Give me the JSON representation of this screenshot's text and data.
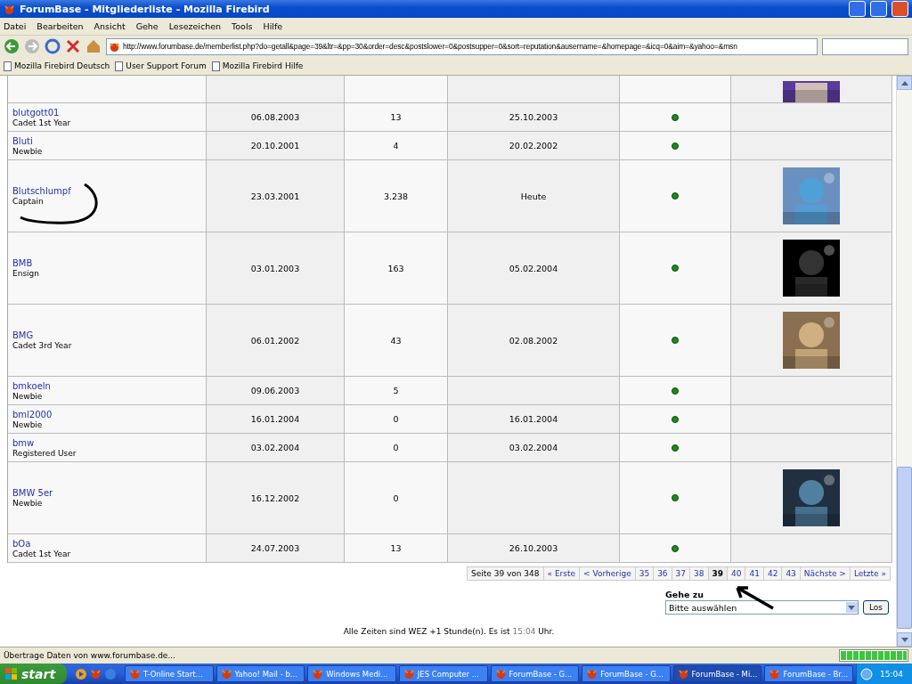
{
  "window": {
    "title": "ForumBase - Mitgliederliste - Mozilla Firebird"
  },
  "menu": [
    "Datei",
    "Bearbeiten",
    "Ansicht",
    "Gehe",
    "Lesezeichen",
    "Tools",
    "Hilfe"
  ],
  "address": {
    "url": "http://www.forumbase.de/memberlist.php?do=getall&page=39&ltr=&pp=30&order=desc&postslower=0&postsupper=0&sort=reputation&ausername=&homepage=&icq=0&aim=&yahoo=&msn"
  },
  "bookmarks": [
    "Mozilla Firebird Deutsch",
    "User Support Forum",
    "Mozilla Firebird Hilfe"
  ],
  "members": [
    {
      "has_avatar": true
    },
    {
      "name": "blutgott01",
      "rank": "Cadet 1st Year",
      "joined": "06.08.2003",
      "posts": "13",
      "last_post": "25.10.2003",
      "online": true,
      "has_avatar": false
    },
    {
      "name": "Bluti",
      "rank": "Newbie",
      "joined": "20.10.2001",
      "posts": "4",
      "last_post": "20.02.2002",
      "online": true,
      "has_avatar": false
    },
    {
      "name": "Blutschlumpf",
      "rank": "Captain",
      "joined": "23.03.2001",
      "posts": "3.238",
      "last_post": "Heute",
      "online": true,
      "has_avatar": true
    },
    {
      "name": "BMB",
      "rank": "Ensign",
      "joined": "03.01.2003",
      "posts": "163",
      "last_post": "05.02.2004",
      "online": true,
      "has_avatar": true
    },
    {
      "name": "BMG",
      "rank": "Cadet 3rd Year",
      "joined": "06.01.2002",
      "posts": "43",
      "last_post": "02.08.2002",
      "online": true,
      "has_avatar": true
    },
    {
      "name": "bmkoeln",
      "rank": "Newbie",
      "joined": "09.06.2003",
      "posts": "5",
      "online": true,
      "has_avatar": false
    },
    {
      "name": "bml2000",
      "rank": "Newbie",
      "joined": "16.01.2004",
      "posts": "0",
      "last_post": "16.01.2004",
      "online": true,
      "has_avatar": false
    },
    {
      "name": "bmw",
      "rank": "Registered User",
      "joined": "03.02.2004",
      "posts": "0",
      "last_post": "03.02.2004",
      "online": true,
      "has_avatar": false
    },
    {
      "name": "BMW 5er",
      "rank": "Newbie",
      "joined": "16.12.2002",
      "posts": "0",
      "online": true,
      "has_avatar": true
    },
    {
      "name": "bOa",
      "rank": "Cadet 1st Year",
      "joined": "24.07.2003",
      "posts": "13",
      "last_post": "26.10.2003",
      "online": true,
      "has_avatar": false
    }
  ],
  "pagination": {
    "summary": "Seite 39 von 348",
    "links": [
      {
        "label": "« Erste",
        "selected": false
      },
      {
        "label": "< Vorherige",
        "selected": false
      },
      {
        "label": "35",
        "selected": false
      },
      {
        "label": "36",
        "selected": false
      },
      {
        "label": "37",
        "selected": false
      },
      {
        "label": "38",
        "selected": false
      },
      {
        "label": "39",
        "selected": true
      },
      {
        "label": "40",
        "selected": false
      },
      {
        "label": "41",
        "selected": false
      },
      {
        "label": "42",
        "selected": false
      },
      {
        "label": "43",
        "selected": false
      },
      {
        "label": "Nächste >",
        "selected": false
      },
      {
        "label": "Letzte »",
        "selected": false
      }
    ]
  },
  "goto": {
    "label": "Gehe zu",
    "value": "Bitte auswählen",
    "button": "Los"
  },
  "footer": {
    "before": "Alle Zeiten sind WEZ +1 Stunde(n). Es ist ",
    "time": "15:04",
    "after": " Uhr."
  },
  "status_bar": {
    "text": "Übertrage Daten von www.forumbase.de...",
    "level": 1
  },
  "taskbar": {
    "start": "start",
    "items": [
      {
        "label": "T-Online Start...",
        "selected": false
      },
      {
        "label": "Yahoo! Mail - b...",
        "selected": false
      },
      {
        "label": "Windows Medi...",
        "selected": false
      },
      {
        "label": "JES Computer ...",
        "selected": false
      },
      {
        "label": "ForumBase - G...",
        "selected": false
      },
      {
        "label": "ForumBase - G...",
        "selected": false
      },
      {
        "label": "ForumBase - Mi...",
        "selected": true
      },
      {
        "label": "ForumBase - Br...",
        "selected": false
      }
    ],
    "clock": "15:04"
  }
}
